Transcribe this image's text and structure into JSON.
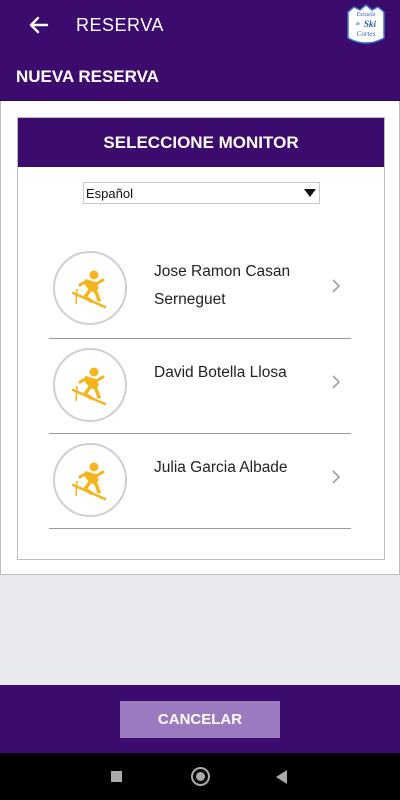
{
  "appbar": {
    "title": "RESERVA",
    "back_icon": "arrow-left-icon",
    "logo_text": [
      "Escuela",
      "de",
      "Ski",
      "Cortes"
    ]
  },
  "subheader": {
    "title": "NUEVA RESERVA"
  },
  "card": {
    "title": "SELECCIONE MONITOR",
    "language_select": {
      "value": "Español",
      "icon": "dropdown-arrow-icon"
    },
    "monitors": [
      {
        "name_line1": "Jose Ramon Casan",
        "name_line2": "Serneguet",
        "icon": "skier-icon"
      },
      {
        "name_line1": "David Botella Llosa",
        "name_line2": "",
        "icon": "skier-icon"
      },
      {
        "name_line1": "Julia Garcia Albade",
        "name_line2": "",
        "icon": "skier-icon"
      }
    ]
  },
  "footer": {
    "cancel_label": "CANCELAR"
  },
  "colors": {
    "primary": "#3c0b6e",
    "accent": "#f5b41e",
    "button": "#9a7bbf"
  },
  "system_nav": {
    "icons": [
      "recents-square-icon",
      "home-circle-icon",
      "back-triangle-icon"
    ]
  }
}
